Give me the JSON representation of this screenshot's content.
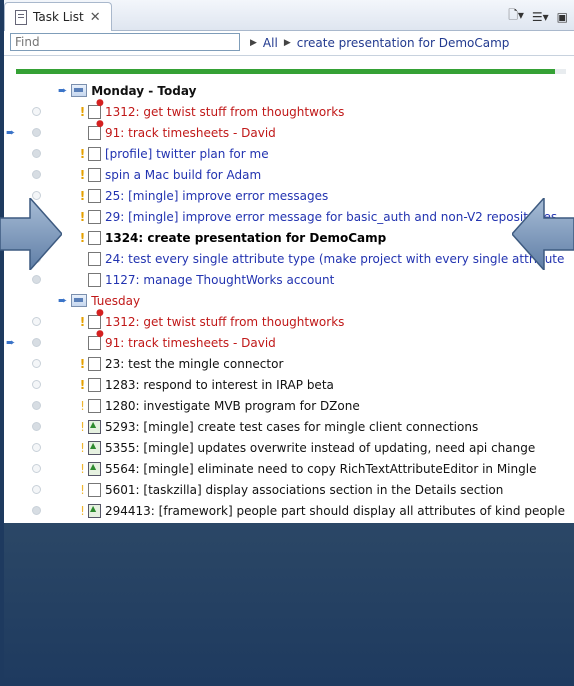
{
  "tab": {
    "title": "Task List",
    "close": "✕"
  },
  "toolbar": {
    "new_icon": "new-task-icon",
    "filter_icon": "filter-icon",
    "menu_icon": "view-menu-icon"
  },
  "find": {
    "placeholder": "Find"
  },
  "crumbs": {
    "all": "All",
    "context": "create presentation for DemoCamp"
  },
  "progress": {
    "fraction": 0.98
  },
  "categories": {
    "monday": "Monday - Today",
    "tuesday": "Tuesday"
  },
  "monday_tasks": [
    "1312: get twist stuff from thoughtworks",
    "91: track timesheets - David",
    "[profile] twitter plan for me",
    "spin a Mac build for Adam",
    "25: [mingle] improve error messages",
    "29: [mingle] improve error message for basic_auth and non-V2 repositories",
    "1324: create presentation for DemoCamp",
    "24: test every single attribute type (make project with every single attribute",
    "1127: manage ThoughtWorks account"
  ],
  "tuesday_tasks": [
    "1312: get twist stuff from thoughtworks",
    "91: track timesheets - David",
    "23: test the mingle connector",
    "1283: respond to interest in IRAP beta",
    "1280: investigate MVB program for DZone",
    "5293: [mingle] create test cases for mingle client connections",
    "5355: [mingle] updates overwrite instead of updating, need api change",
    "5564: [mingle] eliminate need to copy RichTextAttributeEditor in Mingle",
    "5601: [taskzilla] display associations section in the Details section",
    "294413: [framework] people part should display all attributes of kind people"
  ]
}
